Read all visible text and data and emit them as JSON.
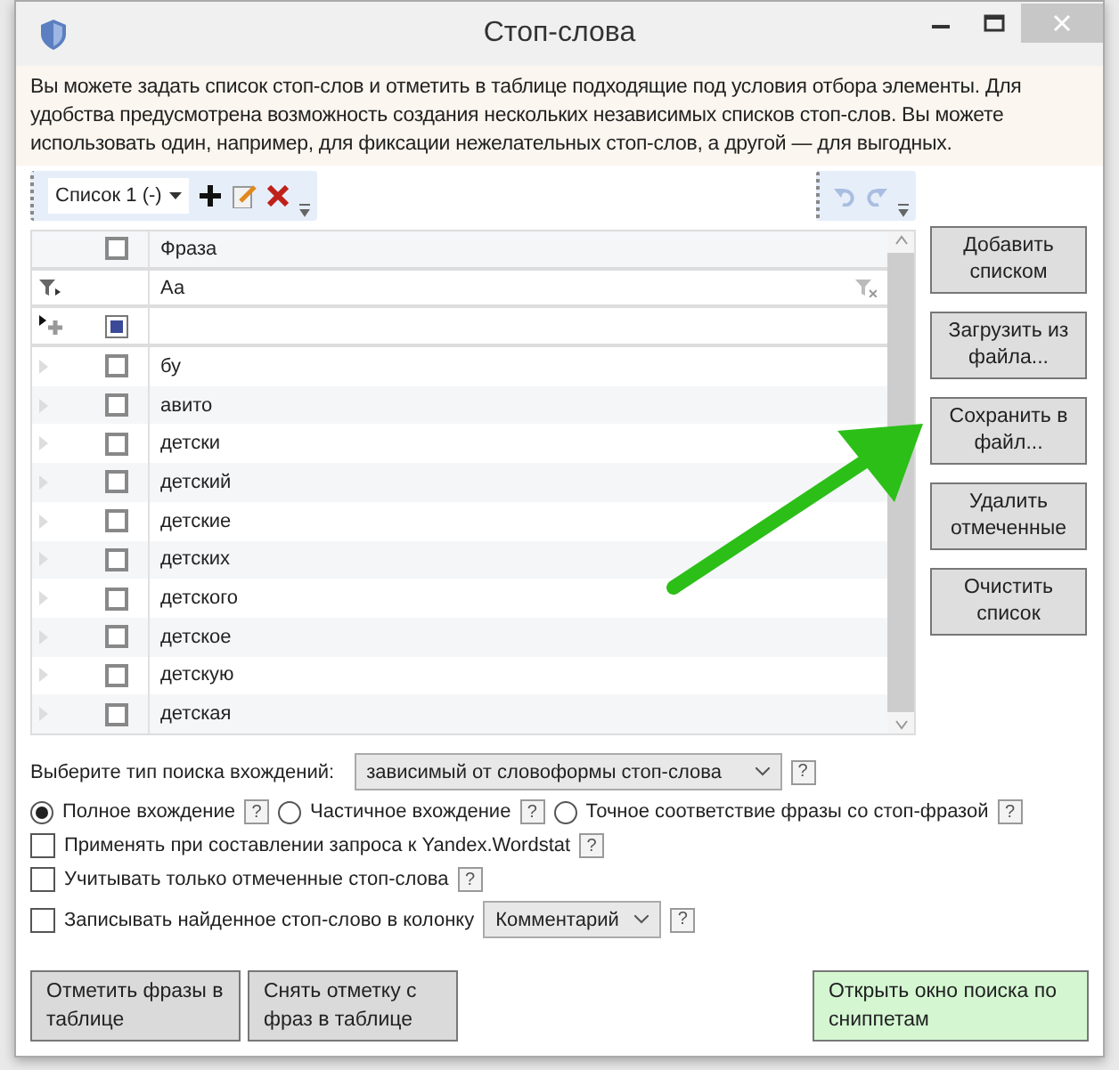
{
  "window": {
    "title": "Стоп-слова"
  },
  "info": "Вы можете задать список стоп-слов и отметить в таблице подходящие под условия отбора элементы. Для удобства предусмотрена возможность создания нескольких независимых списков стоп-слов. Вы можете использовать один, например, для фиксации нежелательных стоп-слов, а другой — для выгодных.",
  "toolbar": {
    "list": "Список 1 (-)"
  },
  "grid": {
    "header_checked": false,
    "column": "Фраза",
    "filter": "Аа",
    "new_row_checked": true,
    "rows": [
      {
        "text": "бу",
        "checked": false
      },
      {
        "text": "авито",
        "checked": false
      },
      {
        "text": "детски",
        "checked": false
      },
      {
        "text": "детский",
        "checked": false
      },
      {
        "text": "детские",
        "checked": false
      },
      {
        "text": "детских",
        "checked": false
      },
      {
        "text": "детского",
        "checked": false
      },
      {
        "text": "детское",
        "checked": false
      },
      {
        "text": "детскую",
        "checked": false
      },
      {
        "text": "детская",
        "checked": false
      }
    ]
  },
  "side_buttons": [
    "Добавить списком",
    "Загрузить из файла...",
    "Сохранить в файл...",
    "Удалить отмеченные",
    "Очистить список"
  ],
  "search_type": {
    "label": "Выберите тип поиска вхождений:",
    "value": "зависимый от словоформы стоп-слова",
    "help": "?"
  },
  "match_modes": [
    {
      "label": "Полное вхождение",
      "selected": true,
      "help": "?"
    },
    {
      "label": "Частичное вхождение",
      "selected": false,
      "help": "?"
    },
    {
      "label": "Точное соответствие фразы со стоп-фразой",
      "selected": false,
      "help": "?"
    }
  ],
  "options": [
    {
      "label": "Применять при составлении запроса к Yandex.Wordstat",
      "checked": false,
      "help": "?"
    },
    {
      "label": "Учитывать только отмеченные стоп-слова",
      "checked": false,
      "help": "?"
    },
    {
      "label": "Записывать найденное стоп-слово в колонку",
      "checked": false,
      "column": "Комментарий",
      "help": "?"
    }
  ],
  "bottom_buttons": [
    {
      "label": "Отметить фразы в таблице",
      "kind": "plain"
    },
    {
      "label": "Снять отметку с фраз в таблице",
      "kind": "plain"
    },
    {
      "label": "Открыть окно поиска по сниппетам",
      "kind": "accent"
    }
  ]
}
